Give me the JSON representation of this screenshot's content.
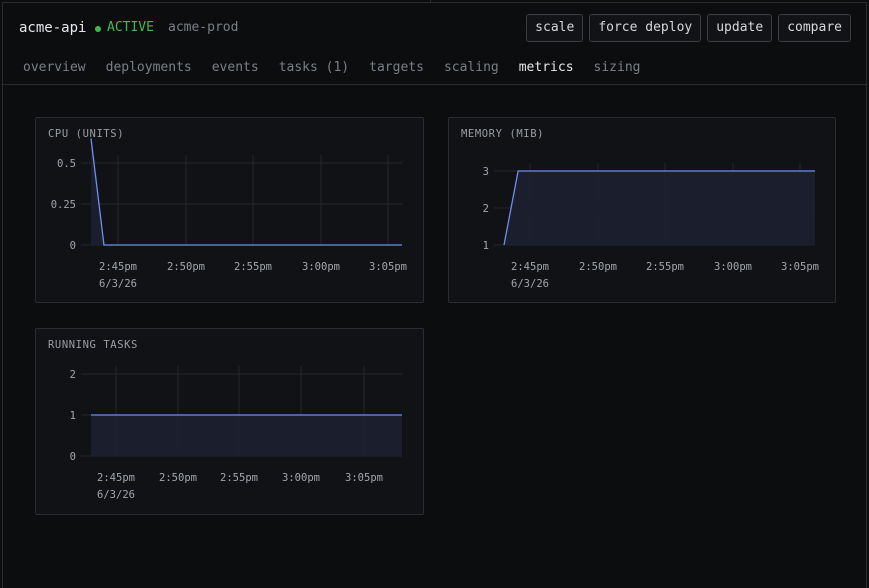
{
  "header": {
    "service_name": "acme-api",
    "status": "ACTIVE",
    "cluster": "acme-prod",
    "actions": [
      "scale",
      "force deploy",
      "update",
      "compare"
    ]
  },
  "tabs": [
    "overview",
    "deployments",
    "events",
    "tasks (1)",
    "targets",
    "scaling",
    "metrics",
    "sizing"
  ],
  "active_tab": "metrics",
  "colors": {
    "accent_line": "#6f8ff0",
    "area_fill": "#1c2030",
    "status_green": "#3fb950"
  },
  "chart_data": [
    {
      "type": "area",
      "title": "CPU (UNITS)",
      "x_ticks": [
        "2:45pm",
        "2:50pm",
        "2:55pm",
        "3:00pm",
        "3:05pm"
      ],
      "x_sublabel": "6/3/26",
      "y_ticks": [
        "0",
        "0.25",
        "0.5"
      ],
      "ylim": [
        0,
        0.5
      ],
      "series": [
        {
          "x": [
            "2:43pm",
            "2:44pm",
            "3:07pm"
          ],
          "values": [
            0.65,
            0,
            0
          ]
        }
      ],
      "grid": true
    },
    {
      "type": "area",
      "title": "MEMORY (MIB)",
      "x_ticks": [
        "2:45pm",
        "2:50pm",
        "2:55pm",
        "3:00pm",
        "3:05pm"
      ],
      "x_sublabel": "6/3/26",
      "y_ticks": [
        "1",
        "2",
        "3"
      ],
      "ylim": [
        1,
        3
      ],
      "series": [
        {
          "x": [
            "2:44pm",
            "2:45pm",
            "3:06pm"
          ],
          "values": [
            1,
            3,
            3
          ]
        }
      ],
      "grid": true
    },
    {
      "type": "area",
      "title": "RUNNING TASKS",
      "x_ticks": [
        "2:45pm",
        "2:50pm",
        "2:55pm",
        "3:00pm",
        "3:05pm"
      ],
      "x_sublabel": "6/3/26",
      "y_ticks": [
        "0",
        "1",
        "2"
      ],
      "ylim": [
        0,
        2
      ],
      "series": [
        {
          "x": [
            "2:44pm",
            "3:07pm"
          ],
          "values": [
            1,
            1
          ]
        }
      ],
      "grid": true
    }
  ]
}
